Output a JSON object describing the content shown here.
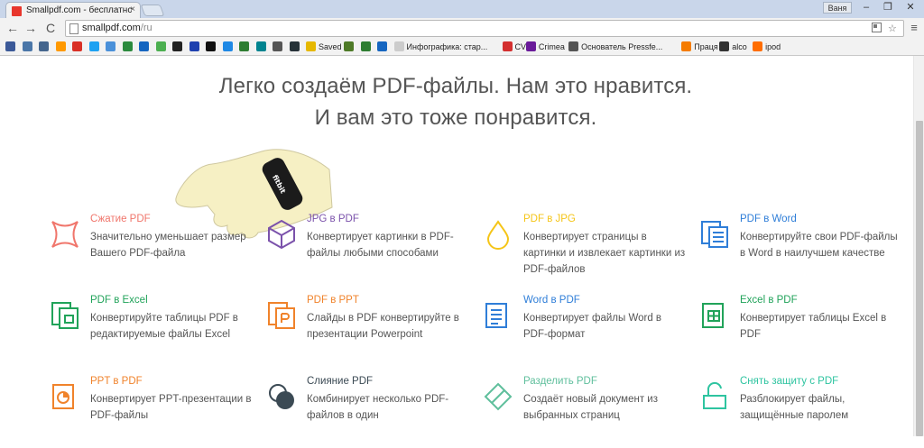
{
  "browser": {
    "tab_title": "Smallpdf.com - бесплатнс",
    "user_badge": "Ваня",
    "url_host": "smallpdf.com",
    "url_path": "/ru",
    "minimize": "–",
    "maximize": "❐",
    "close": "✕",
    "tab_close": "×",
    "back": "←",
    "forward": "→",
    "reload": "C",
    "menu": "≡",
    "star": "☆"
  },
  "bookmarks": [
    {
      "label": "",
      "color": "#3b5998"
    },
    {
      "label": "",
      "color": "#4a76a8"
    },
    {
      "label": "",
      "color": "#45668e"
    },
    {
      "label": "",
      "color": "#ff9900"
    },
    {
      "label": "",
      "color": "#d93025"
    },
    {
      "label": "",
      "color": "#1da1f2"
    },
    {
      "label": "",
      "color": "#4a90d9"
    },
    {
      "label": "",
      "color": "#2b8a3e"
    },
    {
      "label": "",
      "color": "#1565c0"
    },
    {
      "label": "",
      "color": "#4caf50"
    },
    {
      "label": "",
      "color": "#222222"
    },
    {
      "label": "",
      "color": "#1e40af"
    },
    {
      "label": "",
      "color": "#111111"
    },
    {
      "label": "",
      "color": "#1e88e5"
    },
    {
      "label": "",
      "color": "#2e7d32"
    },
    {
      "label": "",
      "color": "#00838f"
    },
    {
      "label": "",
      "color": "#555555"
    },
    {
      "label": "",
      "color": "#263238"
    },
    {
      "label": "Saved",
      "color": "#e6b800"
    },
    {
      "label": "",
      "color": "#4e7a27"
    },
    {
      "label": "",
      "color": "#2e7d32"
    },
    {
      "label": "",
      "color": "#1565c0"
    },
    {
      "label": "Инфографика: стар...",
      "color": "#cccccc"
    },
    {
      "label": "CV",
      "color": "#d32f2f"
    },
    {
      "label": "Crimea",
      "color": "#6a1b9a"
    },
    {
      "label": "Основатель Pressfe...",
      "color": "#555555"
    },
    {
      "label": "Праця",
      "color": "#f57c00"
    },
    {
      "label": "alco",
      "color": "#333333"
    },
    {
      "label": "ipod",
      "color": "#ff6d00"
    }
  ],
  "headline": {
    "line1": "Легко создаём PDF-файлы. Нам это нравится.",
    "line2": "И вам это тоже понравится."
  },
  "tools": [
    {
      "title": "Сжатие PDF",
      "desc": "Значительно уменьшает размер Вашего PDF-файла",
      "color": "#f0766c",
      "icon": "compress-icon"
    },
    {
      "title": "JPG в PDF",
      "desc": "Конвертирует картинки в PDF-файлы любыми способами",
      "color": "#7b52ab",
      "icon": "cube-icon"
    },
    {
      "title": "PDF в JPG",
      "desc": "Конвертирует страницы в картинки и извлекает картинки из PDF-файлов",
      "color": "#f5c518",
      "icon": "drop-icon"
    },
    {
      "title": "PDF в Word",
      "desc": "Конвертируйте свои PDF-файлы в Word в наилучшем качестве",
      "color": "#2f7ed8",
      "icon": "word-doc-icon"
    },
    {
      "title": "PDF в Excel",
      "desc": "Конвертируйте таблицы PDF в редактируемые файлы Excel",
      "color": "#21a35a",
      "icon": "excel-doc-icon"
    },
    {
      "title": "PDF в PPT",
      "desc": "Слайды в PDF конвертируйте в презентации Powerpoint",
      "color": "#f0832b",
      "icon": "ppt-doc-icon"
    },
    {
      "title": "Word в PDF",
      "desc": "Конвертирует файлы Word в PDF-формат",
      "color": "#2f7ed8",
      "icon": "word-lines-icon"
    },
    {
      "title": "Excel в PDF",
      "desc": "Конвертирует таблицы Excel в PDF",
      "color": "#21a35a",
      "icon": "excel-grid-icon"
    },
    {
      "title": "PPT в PDF",
      "desc": "Конвертирует PPT-презентации в PDF-файлы",
      "color": "#f0832b",
      "icon": "ppt-pie-icon"
    },
    {
      "title": "Слияние PDF",
      "desc": "Комбинирует несколько PDF-файлов в один",
      "color": "#3b4a54",
      "icon": "merge-icon"
    },
    {
      "title": "Разделить PDF",
      "desc": "Создаёт новый документ из выбранных страниц",
      "color": "#5fbf9c",
      "icon": "split-icon"
    },
    {
      "title": "Снять защиту с PDF",
      "desc": "Разблокирует файлы, защищённые паролем",
      "color": "#2ec4a0",
      "icon": "unlock-icon"
    }
  ]
}
